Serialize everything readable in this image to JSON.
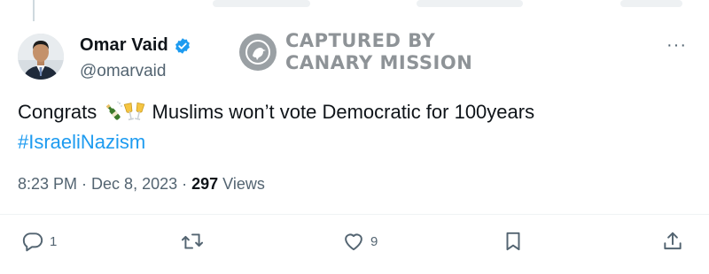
{
  "tweet": {
    "author": {
      "name": "Omar Vaid",
      "handle": "@omarvaid",
      "verified": true
    },
    "text_before": "Congrats ",
    "text_after": " Muslims won’t vote Democratic for 100years",
    "emojis": [
      "bottle-with-popping-cork-icon",
      "clinking-glasses-icon"
    ],
    "hashtag": "#IsraeliNazism",
    "time": "8:23 PM",
    "separator": " · ",
    "date": "Dec 8, 2023",
    "views_count": "297",
    "views_label": " Views"
  },
  "watermark": {
    "line1": "CAPTURED BY",
    "line2": "CANARY MISSION"
  },
  "more_label": "···",
  "actions": {
    "reply_count": "1",
    "retweet_count": "",
    "like_count": "9"
  },
  "colors": {
    "accent": "#1d9bf0",
    "text": "#0f1419",
    "muted": "#536471",
    "watermark": "#8e9397"
  }
}
